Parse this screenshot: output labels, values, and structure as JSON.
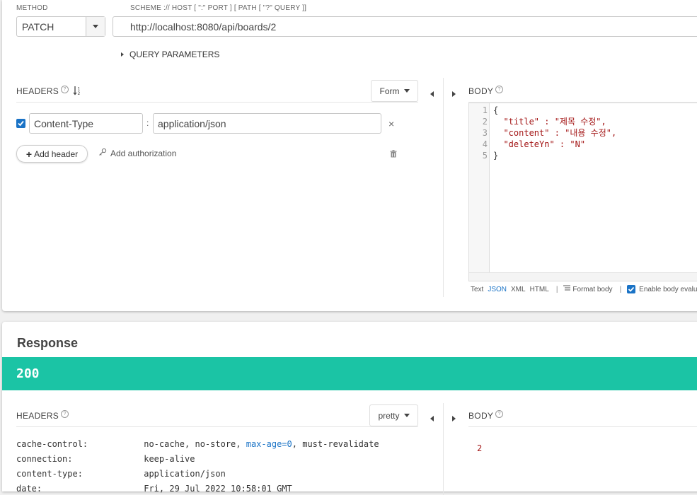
{
  "request": {
    "method_label": "METHOD",
    "method_value": "PATCH",
    "url_label": "SCHEME :// HOST [ \":\" PORT ] [ PATH [ \"?\" QUERY ]]",
    "url_value": "http://localhost:8080/api/boards/2",
    "query_params_label": "QUERY PARAMETERS",
    "headers_label": "HEADERS",
    "headers_mode": "Form",
    "header_rows": [
      {
        "name": "Content-Type",
        "value": "application/json",
        "checked": true
      }
    ],
    "add_header_label": "Add header",
    "add_auth_label": "Add authorization",
    "body_label": "BODY",
    "body_line_numbers": [
      "1",
      "2",
      "3",
      "4",
      "5"
    ],
    "body_lines": [
      "{",
      "  \"title\" : \"제목 수정\",",
      "  \"content\" : \"내용 수정\",",
      "  \"deleteYn\" : \"N\"",
      "}"
    ],
    "body_formats": [
      "Text",
      "JSON",
      "XML",
      "HTML"
    ],
    "body_format_active": "JSON",
    "format_body_label": "Format body",
    "enable_eval_label": "Enable body evaluation"
  },
  "response": {
    "title": "Response",
    "status": "200",
    "status_color": "#1bc4a5",
    "headers_label": "HEADERS",
    "headers_mode": "pretty",
    "body_label": "BODY",
    "body_value": "2",
    "header_rows": [
      {
        "key": "cache-control:",
        "value": "no-cache, no-store, max-age=0, must-revalidate"
      },
      {
        "key": "connection:",
        "value": "keep-alive"
      },
      {
        "key": "content-type:",
        "value": "application/json"
      },
      {
        "key": "date:",
        "value": "Fri, 29 Jul 2022 10:58:01 GMT"
      }
    ]
  },
  "colors": {
    "accent_blue": "#1a73c6",
    "json_key": "#a31515",
    "status_bg": "#1bc4a5"
  }
}
